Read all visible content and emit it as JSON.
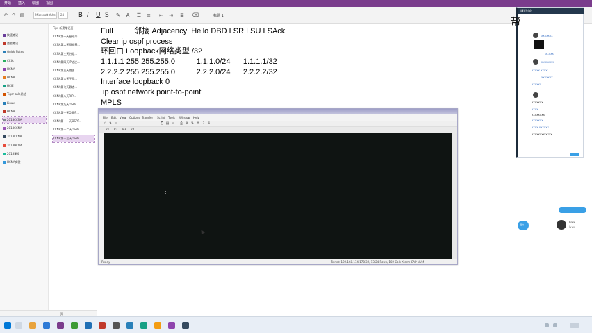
{
  "ribbon": {
    "tabs": [
      "开始",
      "插入",
      "绘图",
      "视图"
    ],
    "font_name": "Microsoft Yahei",
    "font_size": "24",
    "page_title": "标题 1",
    "format_labels": [
      "B",
      "I",
      "U",
      "S"
    ]
  },
  "nav": {
    "sections": [
      {
        "label": "快速笔记",
        "color": "#6a3d9a"
      },
      {
        "label": "重要笔记",
        "color": "#c0392b"
      },
      {
        "label": "Quick Notes",
        "color": "#2c7fb8"
      },
      {
        "label": "CCIA",
        "color": "#27ae60"
      },
      {
        "label": "HCNA",
        "color": "#8e44ad"
      },
      {
        "label": "HCNP",
        "color": "#e67e22"
      },
      {
        "label": "HCIE",
        "color": "#16a085"
      },
      {
        "label": "Tiger sale总结",
        "color": "#d35400"
      },
      {
        "label": "Linux",
        "color": "#2980b9"
      },
      {
        "label": "HCNA",
        "color": "#c0392b"
      },
      {
        "label": "2018CCNA",
        "color": "#7f8c8d"
      },
      {
        "label": "2018CCNA",
        "color": "#9b59b6"
      },
      {
        "label": "2018CCNP",
        "color": "#34495e"
      },
      {
        "label": "2018HCNA",
        "color": "#e74c3c"
      },
      {
        "label": "2018课程",
        "color": "#1abc9c"
      },
      {
        "label": "HCNA实验",
        "color": "#3498db"
      }
    ],
    "pages": [
      "Tips 新建笔记页",
      "CCNA第一天基础介...",
      "CCNA第二天网络基...",
      "CCNA第三天分组...",
      "CCNA第四天IP协议...",
      "CCNA第五天路由...",
      "CCNA第六天子网...",
      "CCNA第七天静态...",
      "CCNA第八天RIP...",
      "CCNA第九天OSPF...",
      "CCNA第十天OSPF...",
      "CCNA第十一天OSPF...",
      "CCNA第十二天OSPF...",
      "CCNA第十三天OSPF..."
    ],
    "footer": "+ 页"
  },
  "note": {
    "lines": [
      "Full          邻接 Adjacency  Hello DBD LSR LSU LSAck",
      "Clear ip ospf process",
      "环回口 Loopback网络类型 /32",
      "1.1.1.1 255.255.255.0          1.1.1.0/24      1.1.1.1/32",
      "2.2.2.2 255.255.255.0          2.2.2.0/24      2.2.2.2/32",
      "Interface loopback 0",
      " ip ospf network point-to-point",
      "MPLS"
    ]
  },
  "terminal": {
    "menu": [
      "File",
      "Edit",
      "View",
      "Options",
      "Transfer",
      "Script",
      "Tools",
      "Window",
      "Help"
    ],
    "sessions": [
      "R1",
      "R2",
      "R3",
      "R4"
    ],
    "status_left": "Ready",
    "status_right": "Telnet: 192.168.174.178     32, 13   24 Rows, 102 Cols   Xterm     CAP NUM"
  },
  "chat": {
    "header": "课堂讨论",
    "big_text": "帮",
    "messages": [
      "xxxxxxx",
      "xxxxx",
      "xxxxxxxx",
      "xxxxx xxxx",
      "xxxxxxx",
      "xxxxxx",
      "xxxxxxx",
      "xxxx",
      "xxxxxxxx",
      "xxxxxxx",
      "xxxx xxxxxx",
      "xxxxxxxx xxxx"
    ],
    "float_label": "99+",
    "user_name": "hlxx",
    "user_sub": "lxxx"
  }
}
